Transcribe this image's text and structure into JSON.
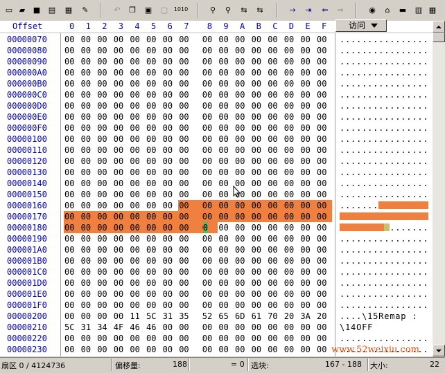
{
  "toolbar": {
    "icons": [
      "new-file-icon",
      "open-folder-icon",
      "save-icon",
      "print-icon",
      "properties-icon",
      "edit-icon",
      "undo-icon",
      "copy-icon",
      "paste-icon",
      "paste-special-icon",
      "binary-icon",
      "find-icon",
      "find-hex-icon",
      "replace-icon",
      "replace-hex-icon",
      "goto-offset-icon",
      "goto-sector-icon",
      "back-icon",
      "forward-icon",
      "disk-icon",
      "network-icon",
      "memory-icon",
      "ram-icon",
      "calculator-icon"
    ],
    "binary_label": "1010"
  },
  "header": {
    "offset_label": "Offset",
    "columns": [
      "0",
      "1",
      "2",
      "3",
      "4",
      "5",
      "6",
      "7",
      "8",
      "9",
      "A",
      "B",
      "C",
      "D",
      "E",
      "F"
    ],
    "access_label": "访问"
  },
  "rows": [
    {
      "offset": "00000070",
      "bytes": [
        "00",
        "00",
        "00",
        "00",
        "00",
        "00",
        "00",
        "00",
        "00",
        "00",
        "00",
        "00",
        "00",
        "00",
        "00",
        "00"
      ],
      "ascii": "................"
    },
    {
      "offset": "00000080",
      "bytes": [
        "00",
        "00",
        "00",
        "00",
        "00",
        "00",
        "00",
        "00",
        "00",
        "00",
        "00",
        "00",
        "00",
        "00",
        "00",
        "00"
      ],
      "ascii": "................"
    },
    {
      "offset": "00000090",
      "bytes": [
        "00",
        "00",
        "00",
        "00",
        "00",
        "00",
        "00",
        "00",
        "00",
        "00",
        "00",
        "00",
        "00",
        "00",
        "00",
        "00"
      ],
      "ascii": "................"
    },
    {
      "offset": "000000A0",
      "bytes": [
        "00",
        "00",
        "00",
        "00",
        "00",
        "00",
        "00",
        "00",
        "00",
        "00",
        "00",
        "00",
        "00",
        "00",
        "00",
        "00"
      ],
      "ascii": "................"
    },
    {
      "offset": "000000B0",
      "bytes": [
        "00",
        "00",
        "00",
        "00",
        "00",
        "00",
        "00",
        "00",
        "00",
        "00",
        "00",
        "00",
        "00",
        "00",
        "00",
        "00"
      ],
      "ascii": "................"
    },
    {
      "offset": "000000C0",
      "bytes": [
        "00",
        "00",
        "00",
        "00",
        "00",
        "00",
        "00",
        "00",
        "00",
        "00",
        "00",
        "00",
        "00",
        "00",
        "00",
        "00"
      ],
      "ascii": "................"
    },
    {
      "offset": "000000D0",
      "bytes": [
        "00",
        "00",
        "00",
        "00",
        "00",
        "00",
        "00",
        "00",
        "00",
        "00",
        "00",
        "00",
        "00",
        "00",
        "00",
        "00"
      ],
      "ascii": "................"
    },
    {
      "offset": "000000E0",
      "bytes": [
        "00",
        "00",
        "00",
        "00",
        "00",
        "00",
        "00",
        "00",
        "00",
        "00",
        "00",
        "00",
        "00",
        "00",
        "00",
        "00"
      ],
      "ascii": "................"
    },
    {
      "offset": "000000F0",
      "bytes": [
        "00",
        "00",
        "00",
        "00",
        "00",
        "00",
        "00",
        "00",
        "00",
        "00",
        "00",
        "00",
        "00",
        "00",
        "00",
        "00"
      ],
      "ascii": "................"
    },
    {
      "offset": "00000100",
      "bytes": [
        "00",
        "00",
        "00",
        "00",
        "00",
        "00",
        "00",
        "00",
        "00",
        "00",
        "00",
        "00",
        "00",
        "00",
        "00",
        "00"
      ],
      "ascii": "................"
    },
    {
      "offset": "00000110",
      "bytes": [
        "00",
        "00",
        "00",
        "00",
        "00",
        "00",
        "00",
        "00",
        "00",
        "00",
        "00",
        "00",
        "00",
        "00",
        "00",
        "00"
      ],
      "ascii": "................"
    },
    {
      "offset": "00000120",
      "bytes": [
        "00",
        "00",
        "00",
        "00",
        "00",
        "00",
        "00",
        "00",
        "00",
        "00",
        "00",
        "00",
        "00",
        "00",
        "00",
        "00"
      ],
      "ascii": "................"
    },
    {
      "offset": "00000130",
      "bytes": [
        "00",
        "00",
        "00",
        "00",
        "00",
        "00",
        "00",
        "00",
        "00",
        "00",
        "00",
        "00",
        "00",
        "00",
        "00",
        "00"
      ],
      "ascii": "................"
    },
    {
      "offset": "00000140",
      "bytes": [
        "00",
        "00",
        "00",
        "00",
        "00",
        "00",
        "00",
        "00",
        "00",
        "00",
        "00",
        "00",
        "00",
        "00",
        "00",
        "00"
      ],
      "ascii": "................"
    },
    {
      "offset": "00000150",
      "bytes": [
        "00",
        "00",
        "00",
        "00",
        "00",
        "00",
        "00",
        "00",
        "00",
        "00",
        "00",
        "00",
        "00",
        "00",
        "00",
        "00"
      ],
      "ascii": "................"
    },
    {
      "offset": "00000160",
      "bytes": [
        "00",
        "00",
        "00",
        "00",
        "00",
        "00",
        "00",
        "00",
        "00",
        "00",
        "00",
        "00",
        "00",
        "00",
        "00",
        "00"
      ],
      "ascii": "................"
    },
    {
      "offset": "00000170",
      "bytes": [
        "00",
        "00",
        "00",
        "00",
        "00",
        "00",
        "00",
        "00",
        "00",
        "00",
        "00",
        "00",
        "00",
        "00",
        "00",
        "00"
      ],
      "ascii": "................"
    },
    {
      "offset": "00000180",
      "bytes": [
        "00",
        "00",
        "00",
        "00",
        "00",
        "00",
        "00",
        "00",
        "00",
        "00",
        "00",
        "00",
        "00",
        "00",
        "00",
        "00"
      ],
      "ascii": "................"
    },
    {
      "offset": "00000190",
      "bytes": [
        "00",
        "00",
        "00",
        "00",
        "00",
        "00",
        "00",
        "00",
        "00",
        "00",
        "00",
        "00",
        "00",
        "00",
        "00",
        "00"
      ],
      "ascii": "................"
    },
    {
      "offset": "000001A0",
      "bytes": [
        "00",
        "00",
        "00",
        "00",
        "00",
        "00",
        "00",
        "00",
        "00",
        "00",
        "00",
        "00",
        "00",
        "00",
        "00",
        "00"
      ],
      "ascii": "................"
    },
    {
      "offset": "000001B0",
      "bytes": [
        "00",
        "00",
        "00",
        "00",
        "00",
        "00",
        "00",
        "00",
        "00",
        "00",
        "00",
        "00",
        "00",
        "00",
        "00",
        "00"
      ],
      "ascii": "................"
    },
    {
      "offset": "000001C0",
      "bytes": [
        "00",
        "00",
        "00",
        "00",
        "00",
        "00",
        "00",
        "00",
        "00",
        "00",
        "00",
        "00",
        "00",
        "00",
        "00",
        "00"
      ],
      "ascii": "................"
    },
    {
      "offset": "000001D0",
      "bytes": [
        "00",
        "00",
        "00",
        "00",
        "00",
        "00",
        "00",
        "00",
        "00",
        "00",
        "00",
        "00",
        "00",
        "00",
        "00",
        "00"
      ],
      "ascii": "................"
    },
    {
      "offset": "000001E0",
      "bytes": [
        "00",
        "00",
        "00",
        "00",
        "00",
        "00",
        "00",
        "00",
        "00",
        "00",
        "00",
        "00",
        "00",
        "00",
        "00",
        "00"
      ],
      "ascii": "................"
    },
    {
      "offset": "000001F0",
      "bytes": [
        "00",
        "00",
        "00",
        "00",
        "00",
        "00",
        "00",
        "00",
        "00",
        "00",
        "00",
        "00",
        "00",
        "00",
        "00",
        "00"
      ],
      "ascii": "................"
    },
    {
      "offset": "00000200",
      "bytes": [
        "00",
        "00",
        "00",
        "00",
        "11",
        "5C",
        "31",
        "35",
        "52",
        "65",
        "6D",
        "61",
        "70",
        "20",
        "3A",
        "20"
      ],
      "ascii": "....\\15Remap : "
    },
    {
      "offset": "00000210",
      "bytes": [
        "5C",
        "31",
        "34",
        "4F",
        "46",
        "46",
        "00",
        "00",
        "00",
        "00",
        "00",
        "00",
        "00",
        "00",
        "00",
        "00"
      ],
      "ascii": "\\14OFF"
    },
    {
      "offset": "00000220",
      "bytes": [
        "00",
        "00",
        "00",
        "00",
        "00",
        "00",
        "00",
        "00",
        "00",
        "00",
        "00",
        "00",
        "00",
        "00",
        "00",
        "00"
      ],
      "ascii": "................"
    },
    {
      "offset": "00000230",
      "bytes": [
        "00",
        "00",
        "00",
        "00",
        "00",
        "00",
        "00",
        "00",
        "00",
        "00",
        "00",
        "00",
        "00",
        "00",
        "00",
        "00"
      ],
      "ascii": "................"
    }
  ],
  "status": {
    "sector_label": "扇区 0 / 4124736",
    "offset_label": "偏移量:",
    "offset_value": "188",
    "value_label": "= 0",
    "block_label": "选块:",
    "block_value": "167 - 188",
    "size_label": "大小:",
    "size_value": "22"
  },
  "watermark": "www.52weixiu.com",
  "colors": {
    "offset_blue": "#0000c0",
    "selection": "#f08040",
    "cursor": "#50c050"
  }
}
